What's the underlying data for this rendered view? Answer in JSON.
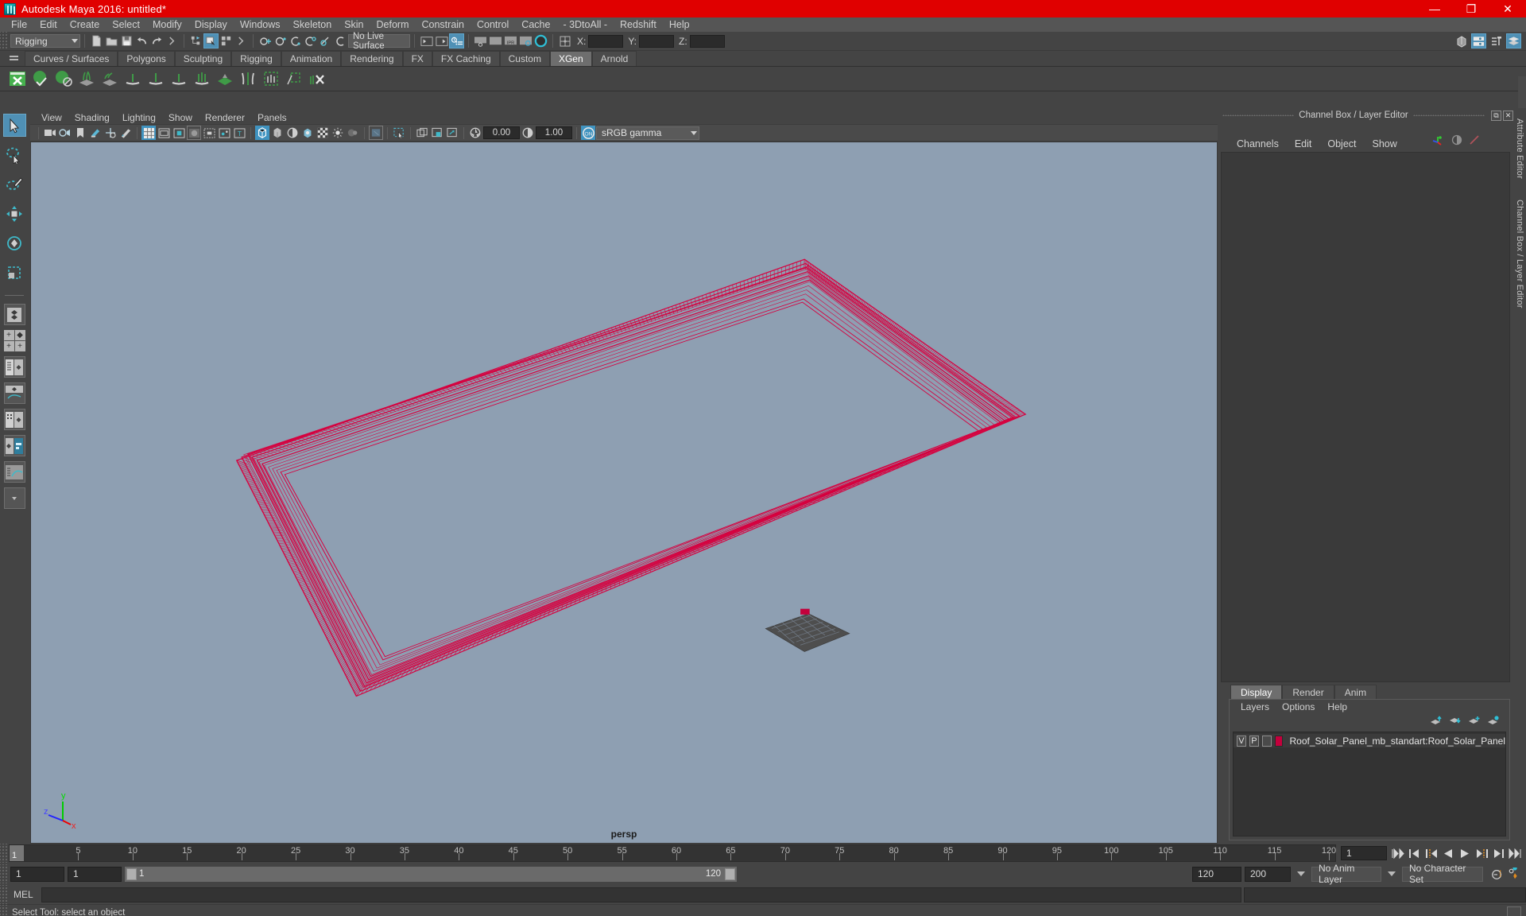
{
  "window": {
    "title": "Autodesk Maya 2016: untitled*",
    "minimize": "—",
    "maximize": "❐",
    "close": "✕"
  },
  "menubar": {
    "items": [
      "File",
      "Edit",
      "Create",
      "Select",
      "Modify",
      "Display",
      "Windows",
      "Skeleton",
      "Skin",
      "Deform",
      "Constrain",
      "Control",
      "Cache",
      "- 3DtoAll -",
      "Redshift",
      "Help"
    ]
  },
  "statusline": {
    "menu_set": "Rigging",
    "live_surface": "No Live Surface",
    "x_label": "X:",
    "y_label": "Y:",
    "z_label": "Z:",
    "x_value": "",
    "y_value": "",
    "z_value": ""
  },
  "shelf": {
    "tabs": [
      "Curves / Surfaces",
      "Polygons",
      "Sculpting",
      "Rigging",
      "Animation",
      "Rendering",
      "FX",
      "FX Caching",
      "Custom",
      "XGen",
      "Arnold"
    ],
    "active_tab": "XGen"
  },
  "viewport": {
    "menus": [
      "View",
      "Shading",
      "Lighting",
      "Show",
      "Renderer",
      "Panels"
    ],
    "exposure": "0.00",
    "gamma": "1.00",
    "color_profile": "sRGB gamma",
    "camera_label": "persp",
    "axis_x": "x",
    "axis_y": "y",
    "axis_z": "z"
  },
  "channel_box": {
    "panel_title": "Channel Box / Layer Editor",
    "menus": [
      "Channels",
      "Edit",
      "Object",
      "Show"
    ]
  },
  "layer_editor": {
    "tabs": [
      "Display",
      "Render",
      "Anim"
    ],
    "active_tab": "Display",
    "menus": [
      "Layers",
      "Options",
      "Help"
    ],
    "rows": [
      {
        "visibility": "V",
        "playback": "P",
        "reference": "",
        "color": "#c4003c",
        "name": "Roof_Solar_Panel_mb_standart:Roof_Solar_Panel"
      }
    ]
  },
  "side_tabs": [
    "Attribute Editor",
    "Channel Box / Layer Editor"
  ],
  "timeline": {
    "start_frame": "1",
    "current_frame": "1",
    "tick_labels": [
      "5",
      "10",
      "15",
      "20",
      "25",
      "30",
      "35",
      "40",
      "45",
      "50",
      "55",
      "60",
      "65",
      "70",
      "75",
      "80",
      "85",
      "90",
      "95",
      "100",
      "105",
      "110",
      "115",
      "120"
    ],
    "tick_values": [
      5,
      10,
      15,
      20,
      25,
      30,
      35,
      40,
      45,
      50,
      55,
      60,
      65,
      70,
      75,
      80,
      85,
      90,
      95,
      100,
      105,
      110,
      115,
      120
    ],
    "range_min": 1,
    "range_max": 120,
    "current_frame_field": "1"
  },
  "range_slider": {
    "anim_start": "1",
    "range_start": "1",
    "range_bar_start": "1",
    "range_bar_end": "120",
    "range_end": "120",
    "anim_end": "200",
    "anim_layer": "No Anim Layer",
    "character_set": "No Character Set"
  },
  "command_line": {
    "label": "MEL",
    "input_value": "",
    "placeholder": ""
  },
  "status_bar": {
    "message": "Select Tool: select an object"
  },
  "scene": {
    "selected_object_color": "#d6003f",
    "mesh_color": "#4a4a4a"
  }
}
